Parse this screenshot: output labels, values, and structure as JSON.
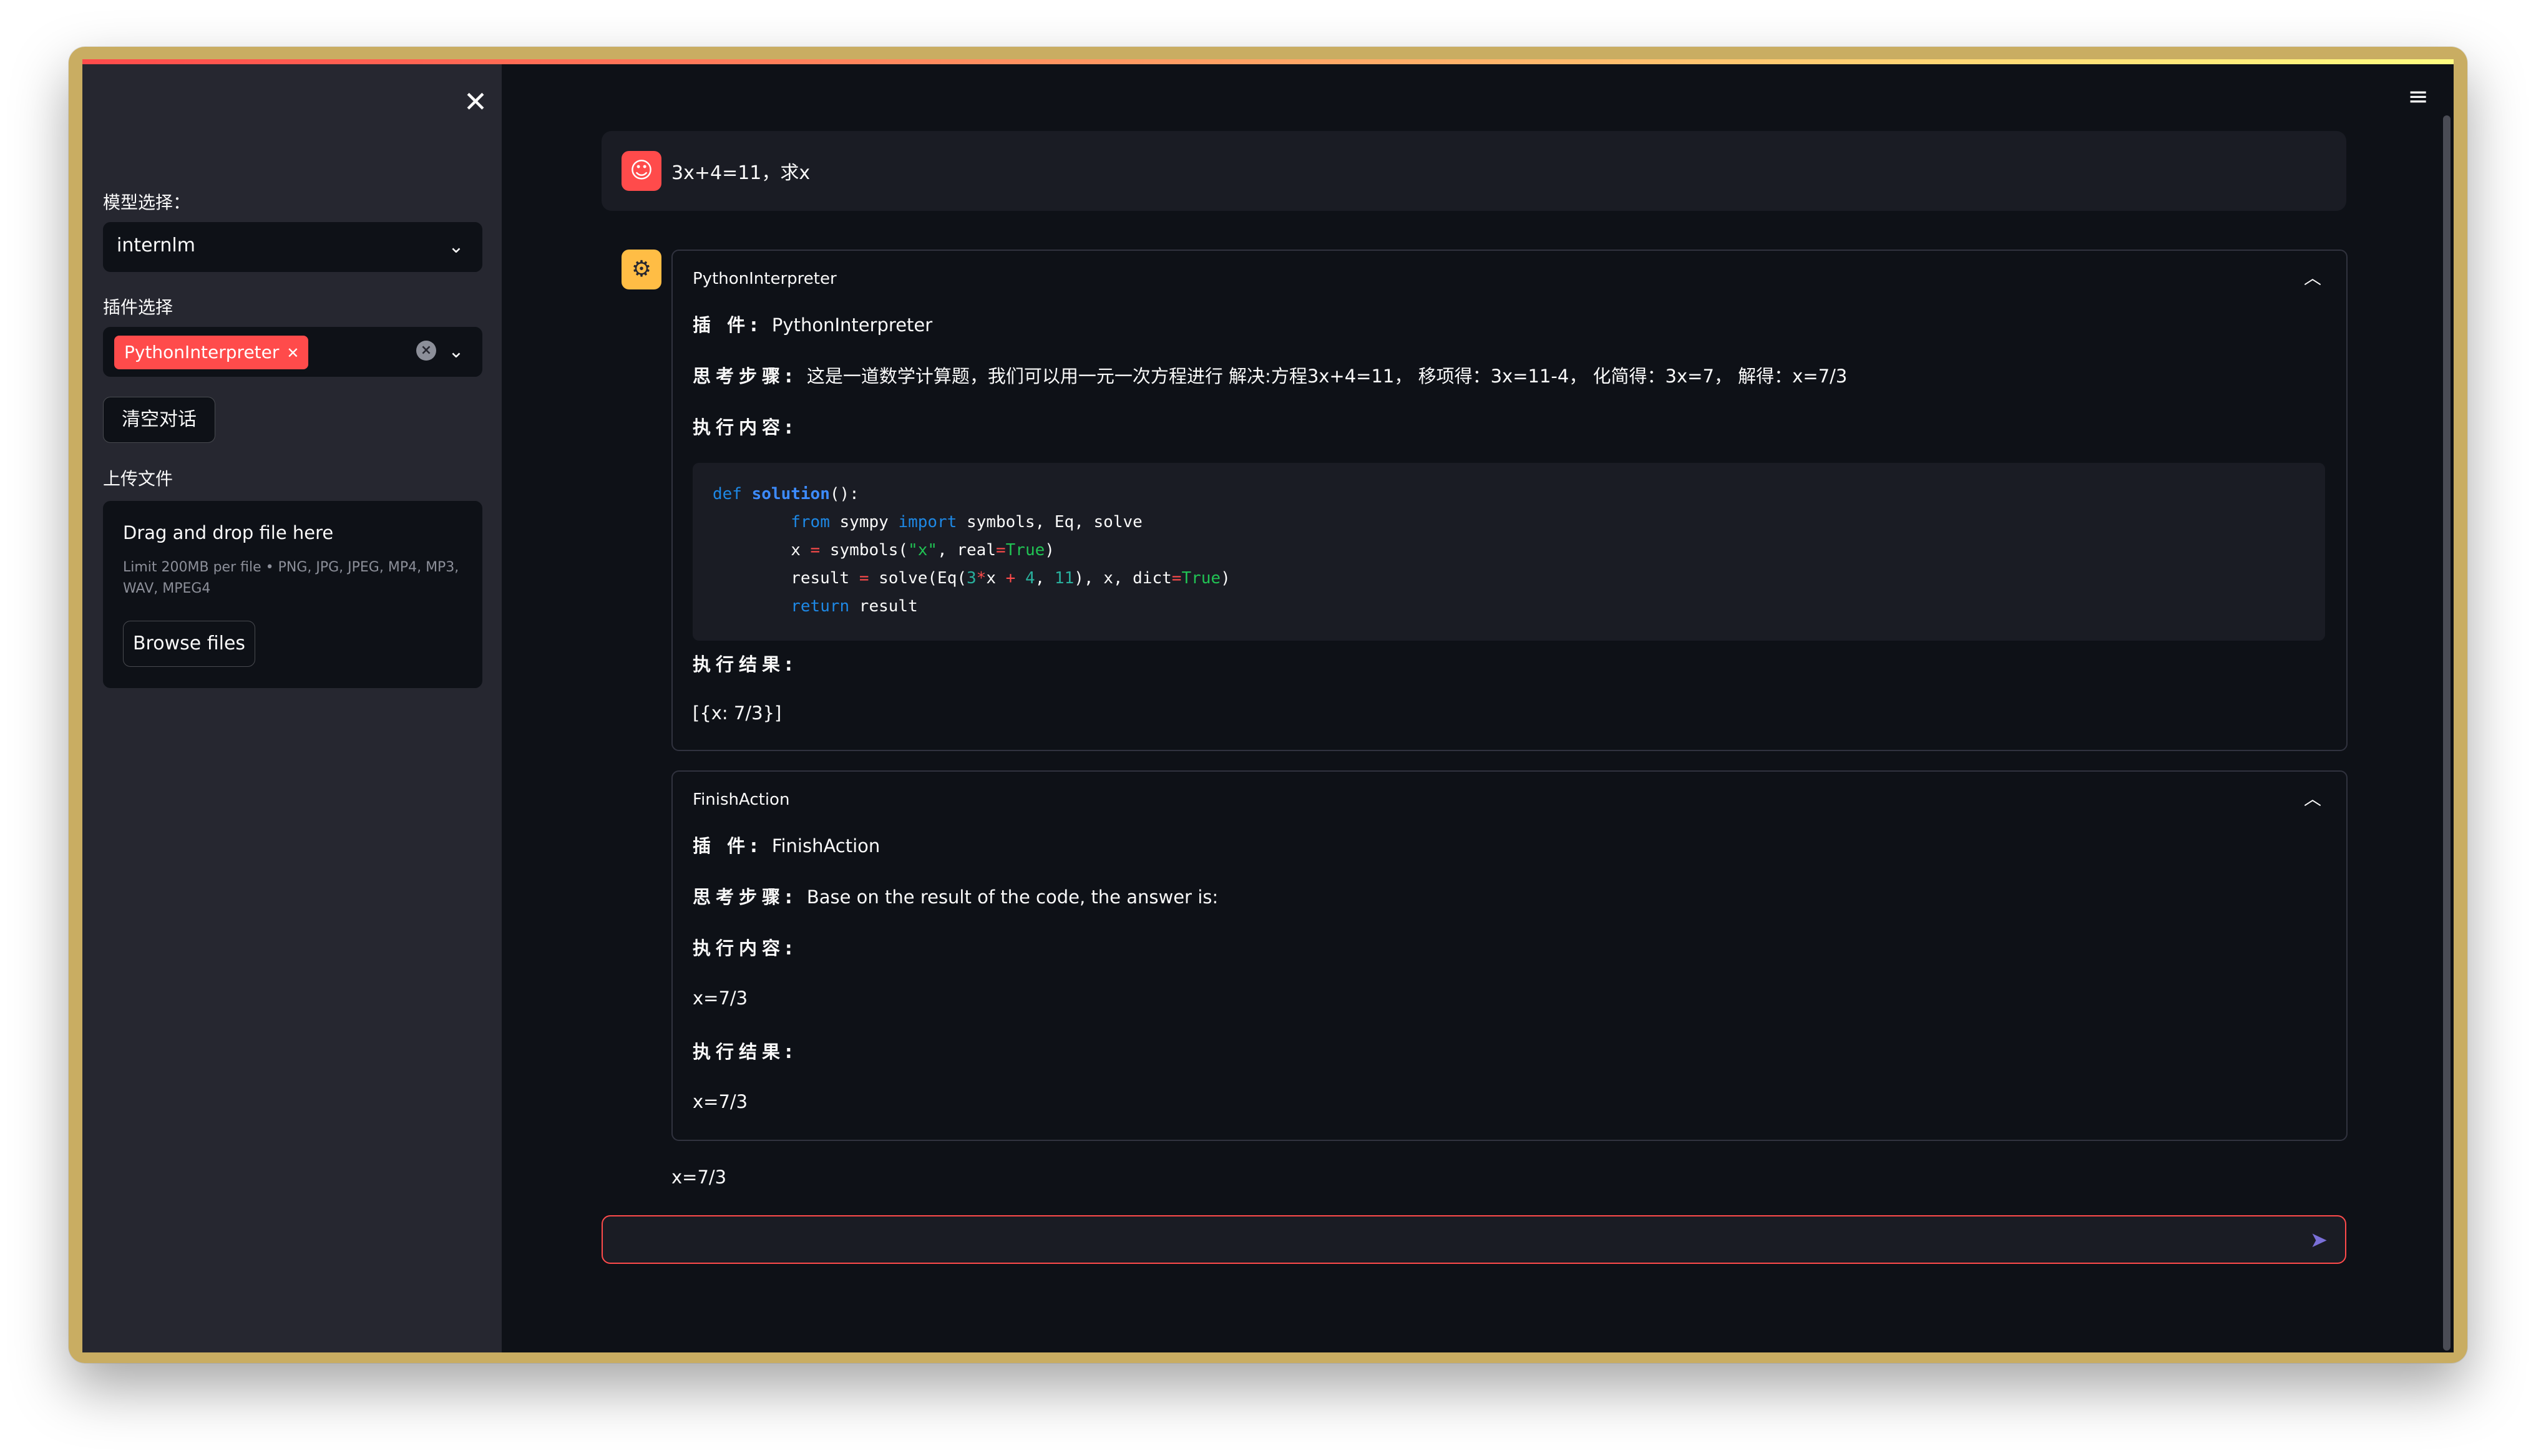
{
  "sidebar": {
    "model_label": "模型选择：",
    "model_value": "internlm",
    "plugin_label": "插件选择",
    "plugin_tag": "PythonInterpreter",
    "clear_button": "清空对话",
    "upload_label": "上传文件",
    "upload_title": "Drag and drop file here",
    "upload_limit": "Limit 200MB per file • PNG, JPG, JPEG, MP4, MP3, WAV, MPEG4",
    "browse_button": "Browse files"
  },
  "chat": {
    "user_message": "3x+4=11，求x",
    "steps": [
      {
        "title": "PythonInterpreter",
        "plugin_label": "插 件:",
        "plugin_value": "PythonInterpreter",
        "thought_label": "思考步骤:",
        "thought_value": "这是一道数学计算题，我们可以用一元一次方程进行 解决:方程3x+4=11， 移项得：3x=11-4， 化简得：3x=7， 解得：x=7/3",
        "content_label": "执行内容:",
        "result_label": "执行结果:",
        "result_value": "[{x: 7/3}]"
      },
      {
        "title": "FinishAction",
        "plugin_label": "插 件:",
        "plugin_value": "FinishAction",
        "thought_label": "思考步骤:",
        "thought_value": "Base on the result of the code, the answer is:",
        "content_label": "执行内容:",
        "content_value": "x=7/3",
        "result_label": "执行结果:",
        "result_value": "x=7/3"
      }
    ],
    "final_answer": "x=7/3"
  },
  "colors": {
    "primary": "#ff4b4b",
    "background": "#0e1117",
    "sidebar": "#262730",
    "assistant_avatar": "#ffbd45"
  },
  "icons": {
    "close": "close-icon",
    "menu": "hamburger-menu-icon",
    "user_avatar": "user-face-icon",
    "assistant_avatar": "robot-icon",
    "send": "send-icon"
  }
}
